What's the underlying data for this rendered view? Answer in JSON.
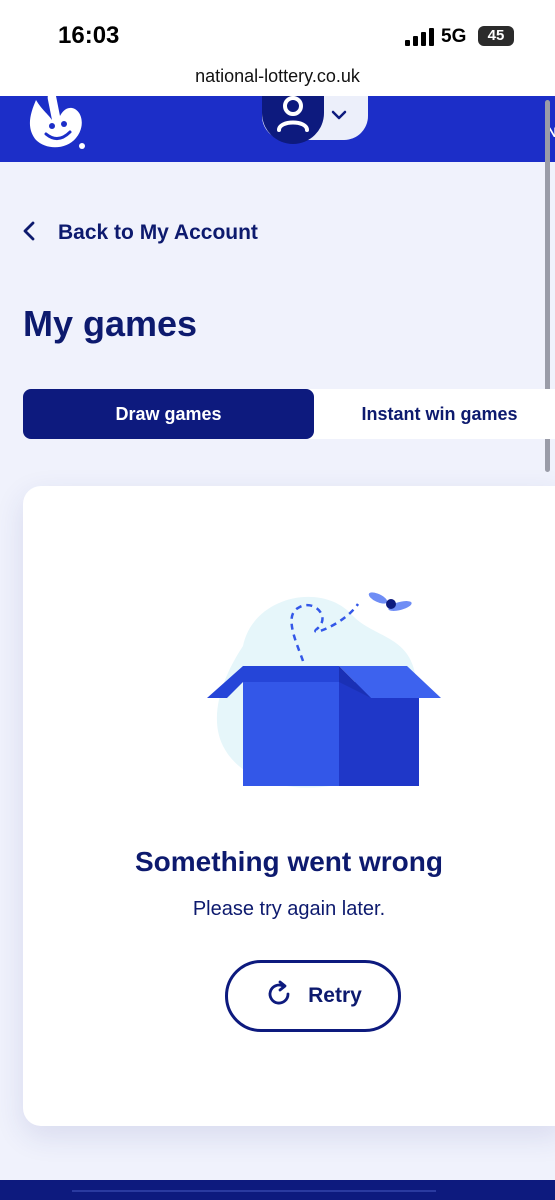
{
  "status_bar": {
    "time": "16:03",
    "network": "5G",
    "battery": "45"
  },
  "browser": {
    "url": "national-lottery.co.uk"
  },
  "header": {
    "logo_icon": "crossed-fingers-logo-icon",
    "account_icon": "user-icon",
    "menu_icon": "chevron-down-icon",
    "edge_letter": "N",
    "brand_color": "#1c2ec8"
  },
  "navigation": {
    "back_label": "Back to My Account",
    "back_icon": "chevron-left-icon"
  },
  "page": {
    "title": "My games"
  },
  "tabs": [
    {
      "label": "Draw games",
      "selected": true
    },
    {
      "label": "Instant win games",
      "selected": false
    }
  ],
  "error_state": {
    "illustration": "empty-box-with-fly-icon",
    "title": "Something went wrong",
    "subtitle": "Please try again later.",
    "retry_label": "Retry",
    "retry_icon": "refresh-icon"
  },
  "colors": {
    "navy": "#0d1a7e",
    "text_navy": "#0d1a6e",
    "box_blue": "#3357e8",
    "background": "#f0f2fc"
  }
}
